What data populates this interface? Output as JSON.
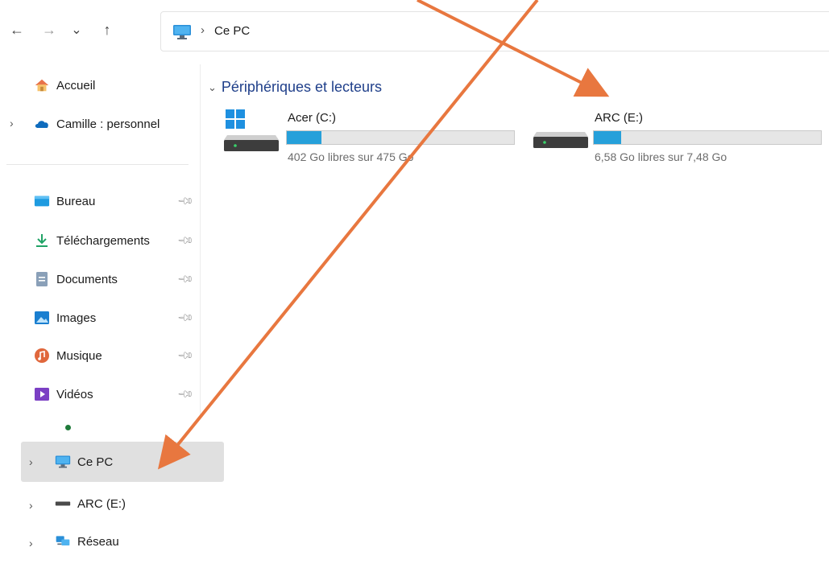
{
  "nav": {
    "back_glyph": "←",
    "forward_glyph": "→",
    "recent_glyph": "⌄",
    "up_glyph": "↑"
  },
  "address": {
    "separator": "›",
    "crumb": "Ce PC"
  },
  "sidebar": {
    "quick": [
      {
        "label": "Accueil",
        "icon": "home-icon"
      },
      {
        "label": "Camille : personnel",
        "icon": "onedrive-cloud-icon"
      }
    ],
    "pinned": [
      {
        "label": "Bureau",
        "icon": "desktop-folder-icon"
      },
      {
        "label": "Téléchargements",
        "icon": "download-icon"
      },
      {
        "label": "Documents",
        "icon": "documents-icon"
      },
      {
        "label": "Images",
        "icon": "images-icon"
      },
      {
        "label": "Musique",
        "icon": "music-icon"
      },
      {
        "label": "Vidéos",
        "icon": "videos-icon"
      }
    ],
    "tree": [
      {
        "label": "Ce PC",
        "icon": "pc-icon",
        "selected": true
      },
      {
        "label": "ARC (E:)",
        "icon": "drive-icon"
      },
      {
        "label": "Réseau",
        "icon": "network-icon"
      }
    ]
  },
  "content": {
    "section_title": "Périphériques et lecteurs",
    "drives": [
      {
        "name": "Acer (C:)",
        "free_text": "402 Go libres sur 475 Go",
        "used_fraction": 0.154,
        "icon": "windows-drive-icon"
      },
      {
        "name": "ARC (E:)",
        "free_text": "6,58 Go libres sur 7,48 Go",
        "used_fraction": 0.12,
        "icon": "hdd-icon"
      }
    ]
  },
  "colors": {
    "accent": "#26a0da",
    "annotation_arrow": "#e8773f",
    "section_title": "#1f3f8a",
    "selected_bg": "#e0e0e0"
  }
}
